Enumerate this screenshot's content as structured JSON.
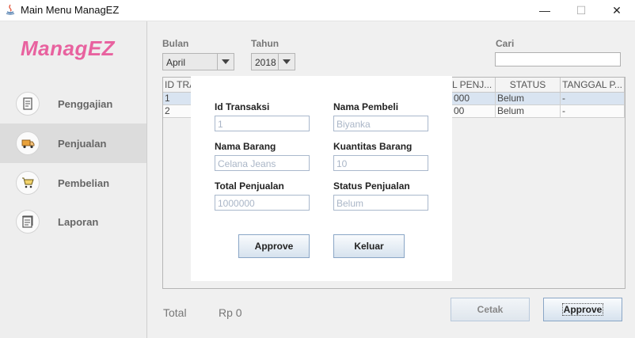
{
  "window": {
    "title": "Main Menu ManagEZ",
    "minimize": "—",
    "maximize": "☐",
    "close": "✕"
  },
  "sidebar": {
    "logo": "ManagEZ",
    "items": [
      {
        "label": "Penggajian",
        "icon": "receipt-icon"
      },
      {
        "label": "Penjualan",
        "icon": "truck-icon",
        "active": true
      },
      {
        "label": "Pembelian",
        "icon": "cart-icon"
      },
      {
        "label": "Laporan",
        "icon": "report-icon"
      }
    ]
  },
  "filters": {
    "bulan_label": "Bulan",
    "bulan_value": "April",
    "tahun_label": "Tahun",
    "tahun_value": "2018",
    "cari_label": "Cari",
    "cari_value": ""
  },
  "table": {
    "headers": [
      "ID TRA",
      "L PENJ...",
      "STATUS",
      "TANGGAL P..."
    ],
    "rows": [
      [
        "1",
        "000",
        "Belum",
        "-"
      ],
      [
        "2",
        "00",
        "Belum",
        "-"
      ]
    ]
  },
  "footer": {
    "total_label": "Total",
    "total_value": "Rp 0",
    "cetak_label": "Cetak",
    "approve_label": "Approve"
  },
  "dialog": {
    "fields": [
      {
        "label": "Id Transaksi",
        "value": "1"
      },
      {
        "label": "Nama Pembeli",
        "value": "Biyanka"
      },
      {
        "label": "Nama Barang",
        "value": "Celana Jeans"
      },
      {
        "label": "Kuantitas Barang",
        "value": "10"
      },
      {
        "label": "Total Penjualan",
        "value": "1000000"
      },
      {
        "label": "Status Penjualan",
        "value": "Belum"
      }
    ],
    "approve_label": "Approve",
    "keluar_label": "Keluar"
  },
  "colors": {
    "logo": "#e8629f",
    "active_nav": "#dcdcdc",
    "selected_row": "#d9e4f1",
    "input_text": "#aab6c7"
  }
}
